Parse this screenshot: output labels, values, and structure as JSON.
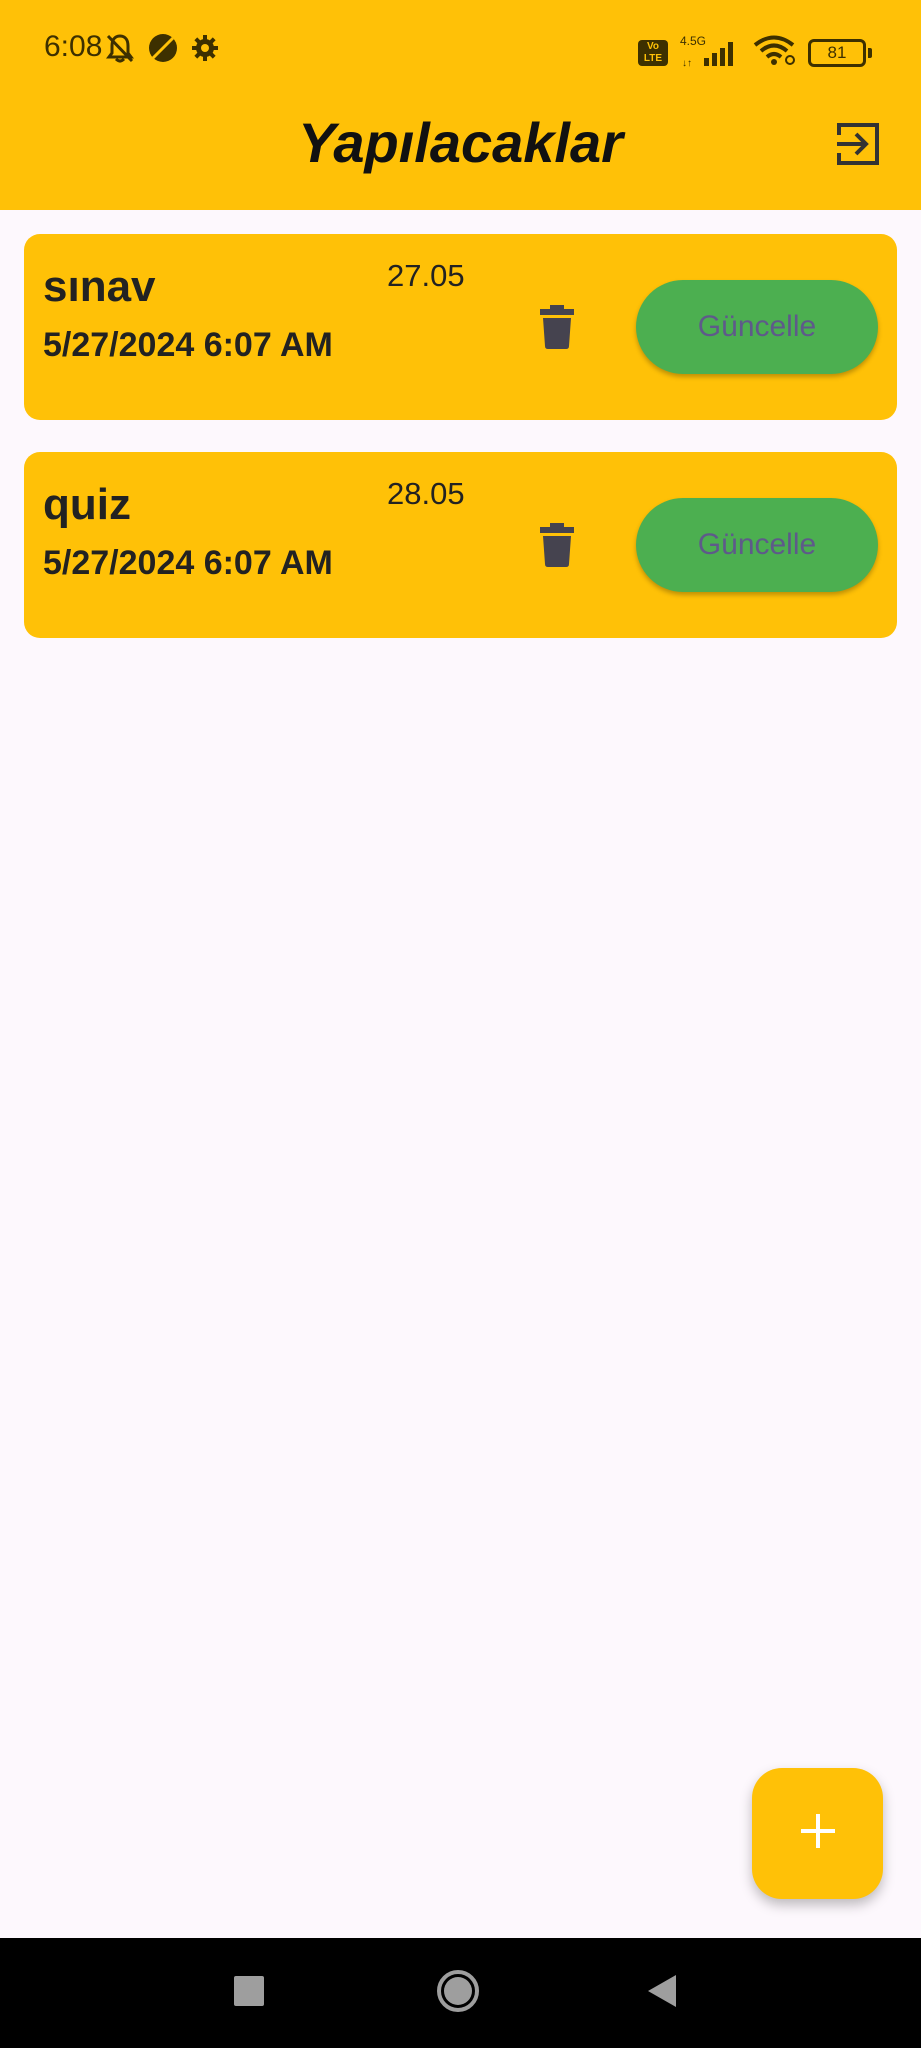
{
  "status_bar": {
    "time": "6:08",
    "volte_label": "Vo\nLTE",
    "network_label": "4.5G",
    "battery_level": "81",
    "icons": [
      "notifications-off-icon",
      "data-saver-icon",
      "settings-icon",
      "volte-icon",
      "cell-signal-icon",
      "wifi-icon",
      "battery-icon"
    ]
  },
  "app_bar": {
    "title": "Yapılacaklar",
    "logout_icon": "logout-icon"
  },
  "todos": [
    {
      "title": "sınav",
      "date": "27.05",
      "created": "5/27/2024 6:07 AM",
      "update_label": "Güncelle",
      "delete_icon": "trash-icon"
    },
    {
      "title": "quiz",
      "date": "28.05",
      "created": "5/27/2024 6:07 AM",
      "update_label": "Güncelle",
      "delete_icon": "trash-icon"
    }
  ],
  "fab": {
    "icon": "plus-icon"
  },
  "nav_bar": {
    "icons": [
      "recents-icon",
      "home-icon",
      "back-icon"
    ]
  },
  "colors": {
    "primary": "#ffc107",
    "update_button": "#4caf50",
    "update_text": "#5e5a8a",
    "background": "#fdf8fd"
  }
}
